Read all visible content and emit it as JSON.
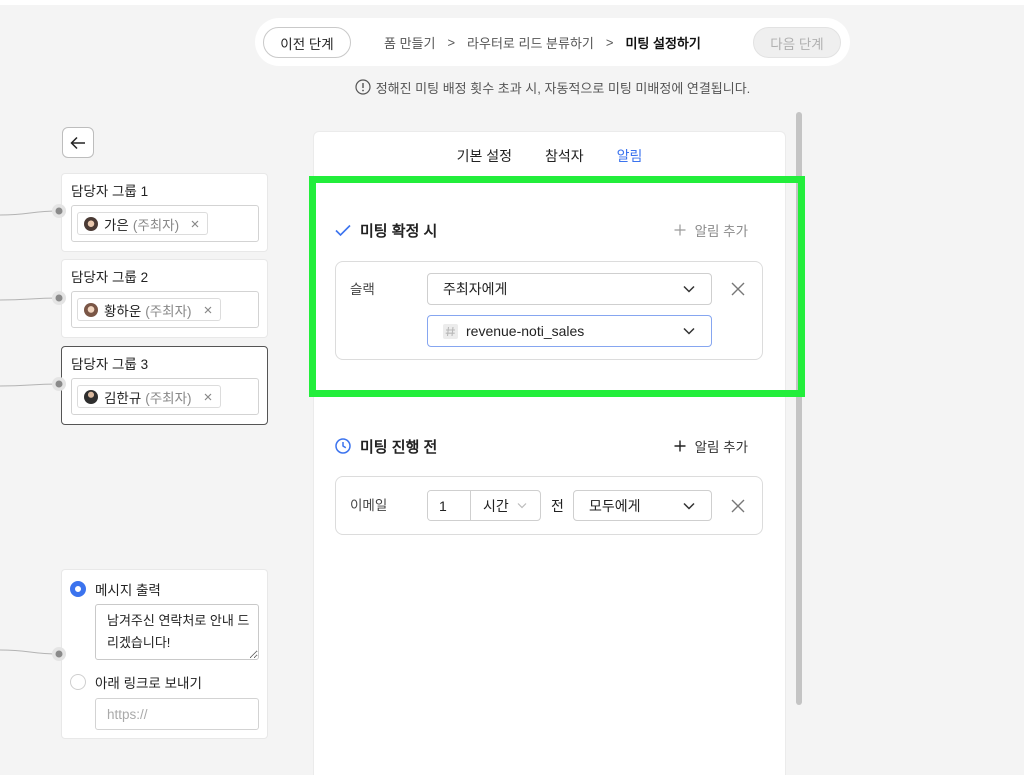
{
  "colors": {
    "accent": "#3b73ee",
    "highlight": "#22ee3b",
    "focus_border": "#86a6f0"
  },
  "breadcrumb_bar": {
    "prev_label": "이전 단계",
    "steps": [
      "폼 만들기",
      "라우터로 리드 분류하기",
      "미팅 설정하기"
    ],
    "separator": ">",
    "next_label": "다음 단계",
    "next_disabled": true
  },
  "notice": {
    "icon": "exclamation-circle-icon",
    "text": "정해진 미팅 배정 횟수 초과 시, 자동적으로 미팅 미배정에 연결됩니다."
  },
  "left": {
    "back_icon": "arrow-left-icon",
    "groups": [
      {
        "title": "담당자 그룹 1",
        "member": {
          "name": "가은",
          "role": "(주최자)"
        },
        "selected": false
      },
      {
        "title": "담당자 그룹 2",
        "member": {
          "name": "황하운",
          "role": "(주최자)"
        },
        "selected": false
      },
      {
        "title": "담당자 그룹 3",
        "member": {
          "name": "김한규",
          "role": "(주최자)"
        },
        "selected": true
      }
    ],
    "message_card": {
      "message_option": {
        "label": "메시지 출력",
        "selected": true
      },
      "message_text": "남겨주신 연락처로 안내 드리겠습니다!",
      "link_option": {
        "label": "아래 링크로 보내기",
        "selected": false
      },
      "link_placeholder": "https://"
    }
  },
  "panel": {
    "tabs": [
      "기본 설정",
      "참석자",
      "알림"
    ],
    "active_tab_index": 2,
    "sections": [
      {
        "icon": "check-icon",
        "title": "미팅 확정 시",
        "add_label": "알림 추가",
        "add_disabled": true,
        "rules": [
          {
            "channel": "슬랙",
            "recipient": "주최자에게",
            "slack_channel": "revenue-noti_sales",
            "slack_channel_focused": true
          }
        ]
      },
      {
        "icon": "clock-icon",
        "title": "미팅 진행 전",
        "add_label": "알림 추가",
        "add_disabled": false,
        "rules": [
          {
            "channel": "이메일",
            "amount": "1",
            "unit": "시간",
            "relation": "전",
            "recipient": "모두에게"
          }
        ]
      }
    ]
  }
}
